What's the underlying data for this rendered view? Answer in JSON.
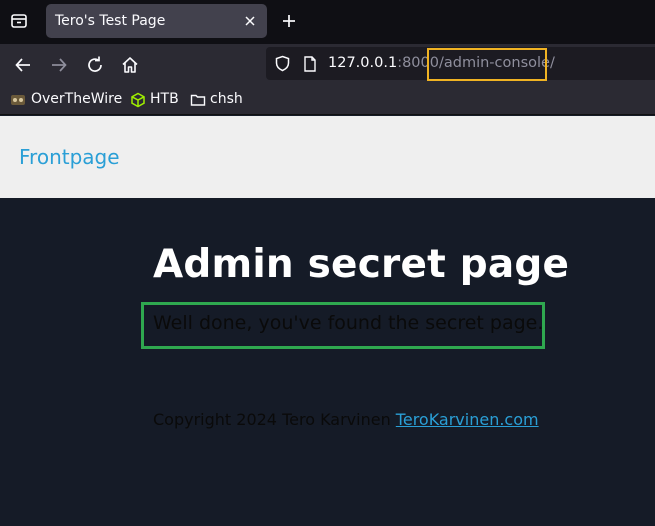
{
  "browser": {
    "tab": {
      "title": "Tero's Test Page"
    },
    "url": {
      "host": "127.0.0.1",
      "port": ":8000",
      "path": "/admin-console/"
    },
    "bookmarks": [
      {
        "label": "OverTheWire",
        "icon": "overthewire-icon"
      },
      {
        "label": "HTB",
        "icon": "htb-cube-icon"
      },
      {
        "label": "chsh",
        "icon": "folder-icon"
      }
    ],
    "colors": {
      "highlight": "#f0b323"
    }
  },
  "page": {
    "nav": {
      "frontpage_label": "Frontpage"
    },
    "title": "Admin secret page",
    "message": "Well done, you've found the secret page.",
    "footer": {
      "copyright": "Copyright 2024 Tero Karvinen ",
      "link_label": "TeroKarvinen.com"
    },
    "colors": {
      "link": "#2a9fd6",
      "background": "#151b27",
      "message_box": "#2fa84f"
    }
  }
}
